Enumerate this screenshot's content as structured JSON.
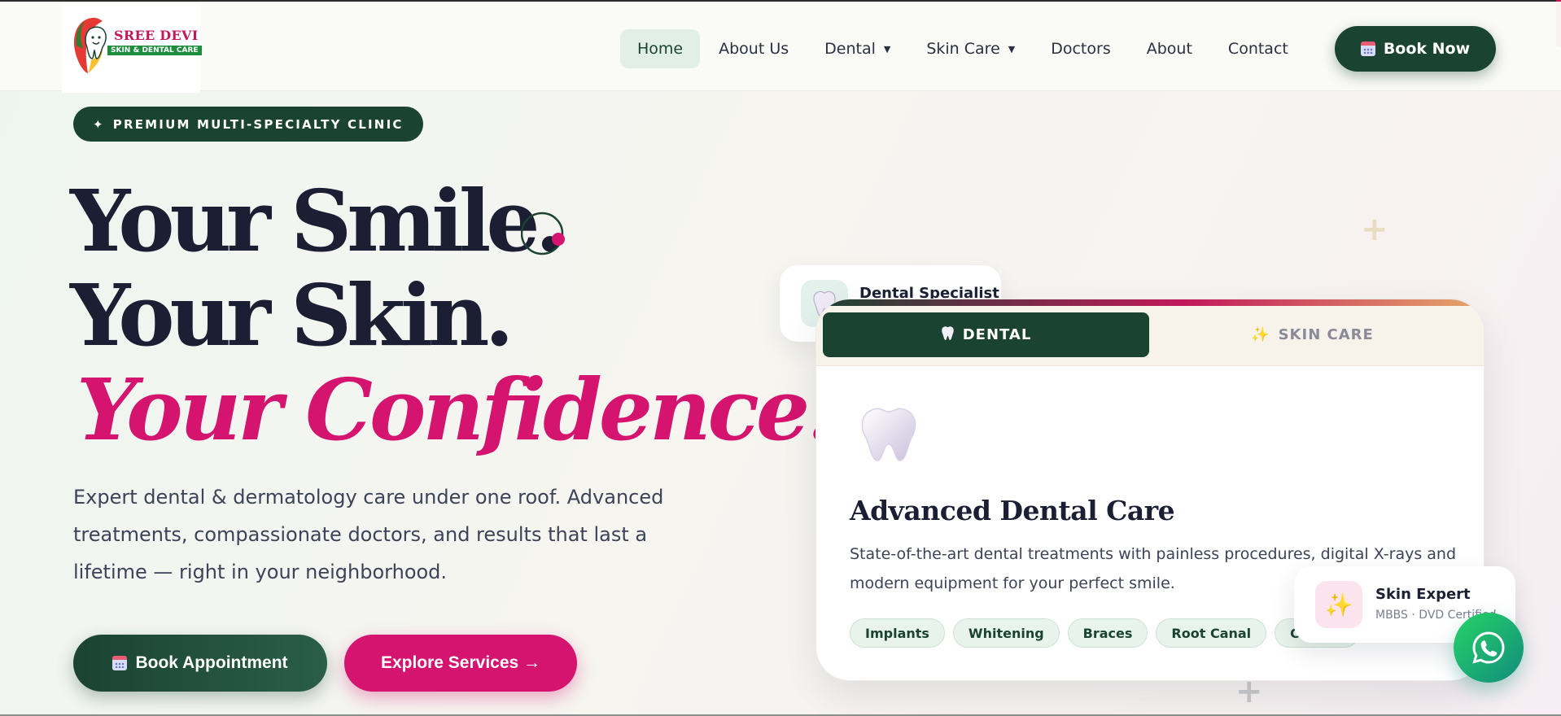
{
  "brand": {
    "name": "SREE DEVI",
    "subtitle": "SKIN & DENTAL CARE"
  },
  "nav": {
    "items": [
      {
        "label": "Home",
        "active": true,
        "dropdown": false
      },
      {
        "label": "About Us",
        "active": false,
        "dropdown": false
      },
      {
        "label": "Dental",
        "active": false,
        "dropdown": true
      },
      {
        "label": "Skin Care",
        "active": false,
        "dropdown": true
      },
      {
        "label": "Doctors",
        "active": false,
        "dropdown": false
      },
      {
        "label": "About",
        "active": false,
        "dropdown": false
      },
      {
        "label": "Contact",
        "active": false,
        "dropdown": false
      }
    ],
    "cta_label": "Book Now",
    "caret_glyph": "▼"
  },
  "hero": {
    "badge_text": "PREMIUM MULTI-SPECIALTY CLINIC",
    "badge_icon": "sparkle-icon",
    "line1": "Your Smile.",
    "line2": "Your Skin.",
    "line3": "Your Confidence.",
    "description": "Expert dental & dermatology care under one roof. Advanced treatments, compassionate doctors, and results that last a lifetime — right in your neighborhood.",
    "primary_button": "Book Appointment",
    "secondary_button": "Explore Services →"
  },
  "floating_cards": {
    "dental_specialist": {
      "title": "Dental Specialist"
    },
    "skin_expert": {
      "title": "Skin Expert",
      "subtitle": "MBBS · DVD Certified"
    }
  },
  "service_card": {
    "tabs": [
      {
        "label": "DENTAL",
        "icon": "tooth-icon",
        "active": true
      },
      {
        "label": "SKIN CARE",
        "icon": "sparkles-icon",
        "active": false
      }
    ],
    "title": "Advanced Dental Care",
    "description": "State-of-the-art dental treatments with painless procedures, digital X-rays and modern equipment for your perfect smile.",
    "chips": [
      "Implants",
      "Whitening",
      "Braces",
      "Root Canal",
      "Crowns"
    ]
  },
  "colors": {
    "primary_green": "#1b4332",
    "accent_pink": "#d4146f",
    "whatsapp_green": "#25d366"
  }
}
